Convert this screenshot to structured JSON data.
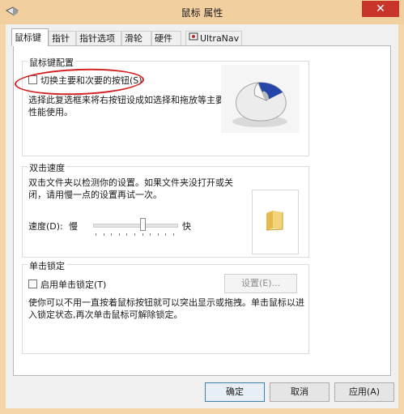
{
  "window": {
    "title": "鼠标 属性",
    "close_label": "✕"
  },
  "tabs": [
    {
      "label": "鼠标键",
      "active": true
    },
    {
      "label": "指针"
    },
    {
      "label": "指针选项"
    },
    {
      "label": "滑轮"
    },
    {
      "label": "硬件"
    },
    {
      "label": "UltraNav",
      "icon": "ultranav-icon"
    }
  ],
  "button_config": {
    "title": "鼠标键配置",
    "checkbox_label": "切换主要和次要的按钮(S)",
    "checked": false,
    "description_line1": "选择此复选框来将右按钮设成如选择和拖放等主要",
    "description_line2": "性能使用。"
  },
  "double_click": {
    "title": "双击速度",
    "description_line1": "双击文件夹以检测你的设置。如果文件夹没打开或关",
    "description_line2": "闭，请用慢一点的设置再试一次。",
    "speed_label": "速度(D):",
    "slow_label": "慢",
    "fast_label": "快",
    "speed_value_fraction": 0.6
  },
  "click_lock": {
    "title": "单击锁定",
    "checkbox_label": "启用单击锁定(T)",
    "checked": false,
    "settings_button": "设置(E)...",
    "description_line1": "使你可以不用一直按着鼠标按钮就可以突出显示或拖拽。单击鼠标以进",
    "description_line2": "入锁定状态,再次单击鼠标可解除锁定。"
  },
  "footer": {
    "ok": "确定",
    "cancel": "取消",
    "apply": "应用(A)"
  },
  "colors": {
    "title_bar": "#f1cf9e",
    "close_button": "#c7352b",
    "annotation": "#d42020"
  }
}
